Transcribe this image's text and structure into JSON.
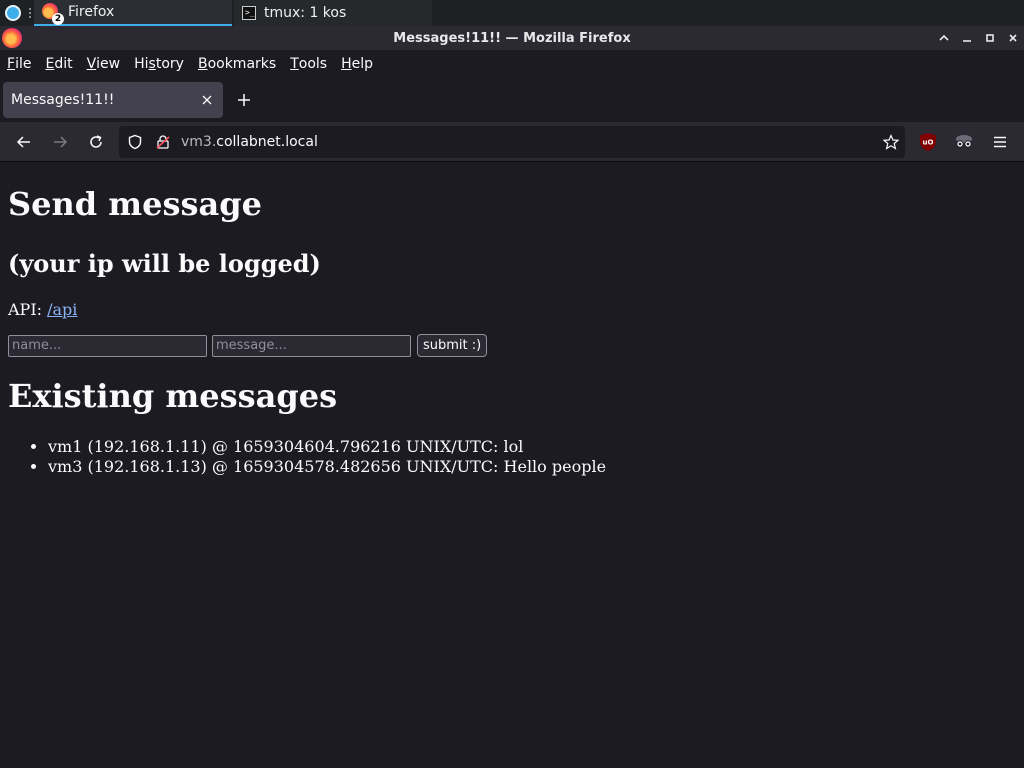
{
  "taskbar": {
    "tasks": [
      {
        "label": "Firefox",
        "badge": "2"
      },
      {
        "label": "tmux: 1 kos"
      }
    ]
  },
  "window": {
    "title": "Messages!11!! — Mozilla Firefox"
  },
  "menubar": {
    "items": [
      {
        "accel": "F",
        "rest": "ile"
      },
      {
        "accel": "E",
        "rest": "dit"
      },
      {
        "accel": "V",
        "rest": "iew"
      },
      {
        "accel": "",
        "pre": "Hi",
        "accel2": "s",
        "rest": "tory"
      },
      {
        "accel": "B",
        "rest": "ookmarks"
      },
      {
        "accel": "T",
        "rest": "ools"
      },
      {
        "accel": "H",
        "rest": "elp"
      }
    ]
  },
  "tabs": [
    {
      "title": "Messages!11!!"
    }
  ],
  "urlbar": {
    "subdomain": "vm3.",
    "domain": "collabnet.local"
  },
  "page": {
    "heading": "Send message",
    "subheading": "(your ip will be logged)",
    "api_label": "API: ",
    "api_link": "/api",
    "form": {
      "name_placeholder": "name...",
      "message_placeholder": "message...",
      "submit_label": "submit :)"
    },
    "messages_heading": "Existing messages",
    "messages": [
      "vm1 (192.168.1.11) @ 1659304604.796216 UNIX/UTC: lol",
      "vm3 (192.168.1.13) @ 1659304578.482656 UNIX/UTC: Hello people"
    ]
  },
  "colors": {
    "accent": "#3daee9",
    "link": "#8ab4f8",
    "page_bg": "#1c1b22",
    "toolbar_bg": "#2b2a33"
  }
}
